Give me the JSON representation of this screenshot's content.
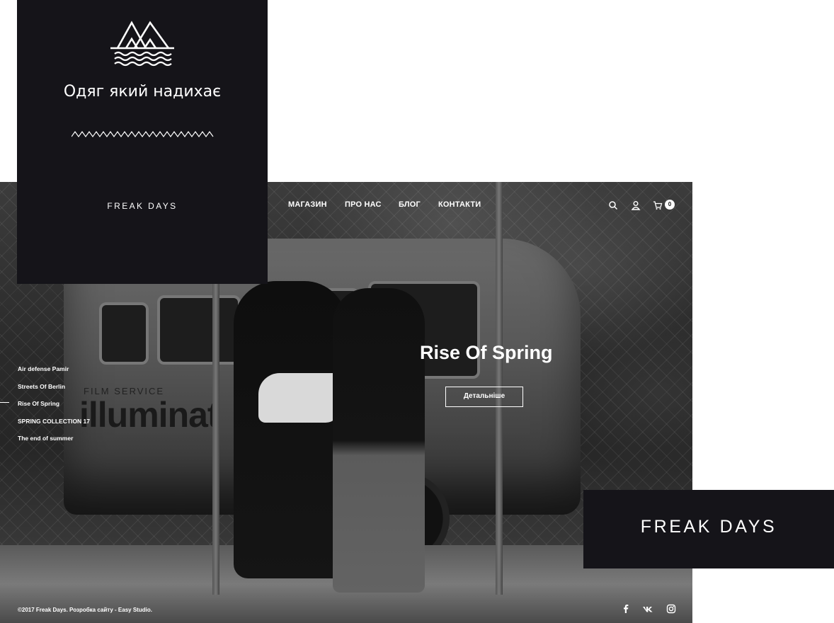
{
  "tagline": "Одяг який надихає",
  "brand": "FREAK DAYS",
  "nav": {
    "items": [
      "МАГАЗИН",
      "ПРО НАС",
      "БЛОГ",
      "КОНТАКТИ"
    ],
    "cart_count": "0"
  },
  "slides": [
    "Air defense Pamir",
    "Streets Of Berlin",
    "Rise Of Spring",
    "SPRING COLLECTION 17",
    "The end of summer"
  ],
  "active_slide": "Rise Of Spring",
  "hero": {
    "title": "Rise Of Spring",
    "button": "Детальніше"
  },
  "footer": {
    "copyright": "©2017 Freak Days. Розробка сайту - Easy Studio."
  },
  "icons": {
    "logo": "mountains-waves-logo",
    "divider": "zigzag-divider",
    "search": "search-icon",
    "account": "user-icon",
    "cart": "cart-icon",
    "social": [
      "facebook-icon",
      "vk-icon",
      "instagram-icon"
    ]
  },
  "colors": {
    "card_bg": "#151419",
    "text": "#ffffff"
  }
}
